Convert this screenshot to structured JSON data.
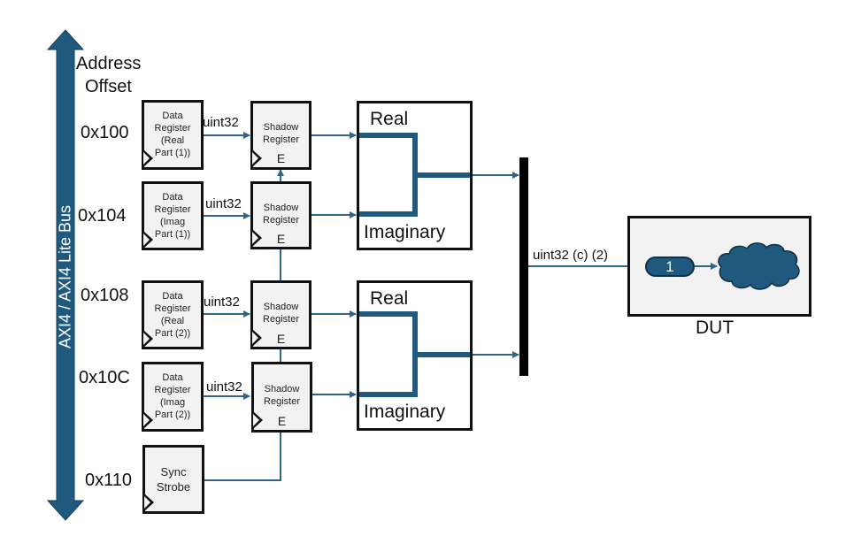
{
  "colors": {
    "bus": "#1f5a7e",
    "wire": "#2e6589",
    "block_fill": "#f2f2f2",
    "border": "#111111"
  },
  "bus": {
    "label": "AXI4  / AXI4 Lite Bus"
  },
  "address_header": {
    "line1": "Address",
    "line2": "Offset"
  },
  "registers": [
    {
      "address": "0x100",
      "data_lines": [
        "Data",
        "Register",
        "(Real",
        "Part (1))"
      ],
      "signal": "uint32",
      "shadow_lines": [
        "Shadow",
        "Register"
      ],
      "enable": "E"
    },
    {
      "address": "0x104",
      "data_lines": [
        "Data",
        "Register",
        "(Imag",
        "Part (1))"
      ],
      "signal": "uint32",
      "shadow_lines": [
        "Shadow",
        "Register"
      ],
      "enable": "E"
    },
    {
      "address": "0x108",
      "data_lines": [
        "Data",
        "Register",
        "(Real",
        "Part (2))"
      ],
      "signal": "uint32",
      "shadow_lines": [
        "Shadow",
        "Register"
      ],
      "enable": "E"
    },
    {
      "address": "0x10C",
      "data_lines": [
        "Data",
        "Register",
        "(Imag",
        "Part (2))"
      ],
      "signal": "uint32",
      "shadow_lines": [
        "Shadow",
        "Register"
      ],
      "enable": "E"
    }
  ],
  "sync_strobe": {
    "address": "0x110",
    "lines": [
      "Sync",
      "Strobe"
    ]
  },
  "complex_blocks": [
    {
      "real_label": "Real",
      "imag_label": "Imaginary"
    },
    {
      "real_label": "Real",
      "imag_label": "Imaginary"
    }
  ],
  "mux_output": {
    "label": "uint32 (c) (2)"
  },
  "dut": {
    "label": "DUT",
    "port_number": "1",
    "subsystem_icon": "cloud-icon"
  }
}
